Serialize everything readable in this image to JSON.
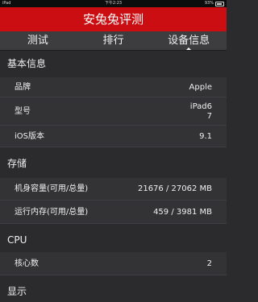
{
  "status_bar": {
    "carrier": "iPad",
    "time": "下午2:23",
    "battery": "93%"
  },
  "app": {
    "title": "安兔兔评测"
  },
  "tabs": [
    {
      "label": "测试",
      "active": false
    },
    {
      "label": "排行",
      "active": false
    },
    {
      "label": "设备信息",
      "active": true
    }
  ],
  "sections": {
    "basic": {
      "title": "基本信息",
      "rows": [
        {
          "key": "品牌",
          "value": "Apple"
        },
        {
          "key": "型号",
          "value": "iPad67"
        },
        {
          "key": "iOS版本",
          "value": "9.1"
        }
      ]
    },
    "storage": {
      "title": "存储",
      "rows": [
        {
          "key": "机身容量(可用/总量)",
          "value": "21676 / 27062 MB"
        },
        {
          "key": "运行内存(可用/总量)",
          "value": "459 / 3981 MB"
        }
      ]
    },
    "cpu": {
      "title": "CPU",
      "rows": [
        {
          "key": "核心数",
          "value": "2"
        }
      ]
    },
    "display": {
      "title": "显示"
    }
  },
  "colors": {
    "header_red": "#cb0e12",
    "background": "#2b2b2d",
    "row": "#333336",
    "tab_bar": "#3d3d40"
  }
}
